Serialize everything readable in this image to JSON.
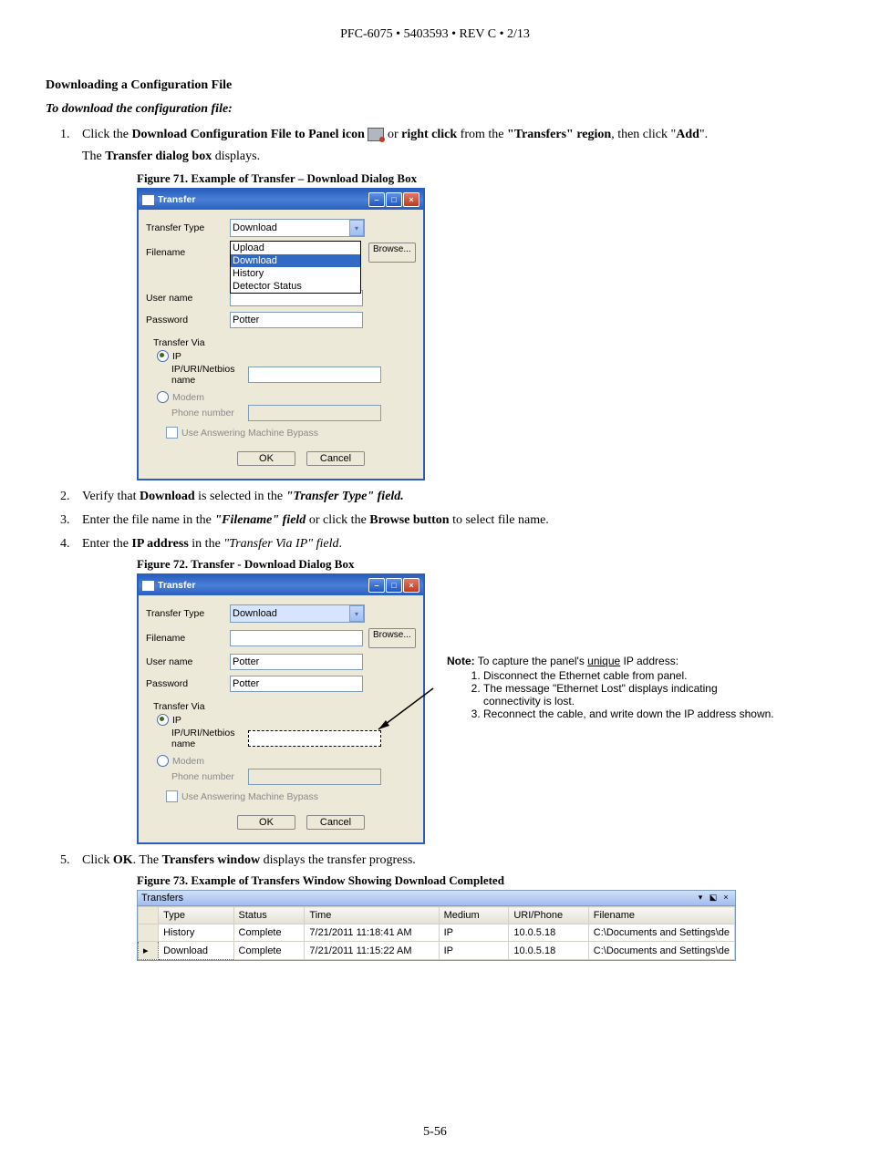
{
  "header": "PFC-6075 • 5403593 • REV C • 2/13",
  "section_title": "Downloading a Configuration File",
  "sub_instruction": "To download the configuration file:",
  "steps": {
    "s1_pre": "Click the ",
    "s1_b1": "Download Configuration File to Panel icon ",
    "s1_mid": " or ",
    "s1_b2": "right click",
    "s1_mid2": " from the ",
    "s1_b3": "\"Transfers\" region",
    "s1_mid3": ", then click \"",
    "s1_b4": "Add",
    "s1_end": "\".",
    "s1_sub_a": "The ",
    "s1_sub_b": "Transfer dialog box",
    "s1_sub_c": " displays.",
    "s2_a": "Verify that ",
    "s2_b": "Download",
    "s2_c": " is selected in the ",
    "s2_d": "\"Transfer Type\" field.",
    "s3_a": "Enter the file name in the ",
    "s3_b": "\"Filename\" field",
    "s3_c": " or click the ",
    "s3_d": "Browse button",
    "s3_e": " to select file name.",
    "s4_a": "Enter the ",
    "s4_b": "IP address",
    "s4_c": " in the ",
    "s4_d": "\"Transfer Via IP\" field",
    "s4_e": ".",
    "s5_a": "Click ",
    "s5_b": "OK",
    "s5_c": ". The ",
    "s5_d": "Transfers window",
    "s5_e": " displays the transfer progress."
  },
  "captions": {
    "fig71": "Figure 71.  Example of Transfer – Download Dialog Box",
    "fig72": "Figure 72.  Transfer - Download Dialog Box",
    "fig73": "Figure 73. Example of Transfers Window Showing Download Completed"
  },
  "dialog": {
    "title": "Transfer",
    "labels": {
      "transfer_type": "Transfer Type",
      "filename": "Filename",
      "user_name": "User name",
      "password": "Password",
      "transfer_via": "Transfer Via",
      "ip": "IP",
      "ip_field": "IP/URI/Netbios name",
      "modem": "Modem",
      "phone": "Phone number",
      "bypass": "Use Answering Machine Bypass"
    },
    "select_value": "Download",
    "dropdown": [
      "Upload",
      "Download",
      "History",
      "Detector Status"
    ],
    "values_fig72": {
      "user": "Potter",
      "password": "Potter"
    },
    "buttons": {
      "browse": "Browse...",
      "ok": "OK",
      "cancel": "Cancel"
    }
  },
  "note": {
    "prefix": "Note:",
    "text": " To capture the panel's ",
    "underline": "unique",
    "text2": " IP address:",
    "items": [
      "Disconnect the Ethernet cable from panel.",
      "The message \"Ethernet Lost\" displays indicating connectivity is lost.",
      "Reconnect the cable, and write down the IP address shown."
    ]
  },
  "transfers": {
    "title": "Transfers",
    "pin": "▾ ⬕",
    "columns": [
      "Type",
      "Status",
      "Time",
      "Medium",
      "URI/Phone",
      "Filename"
    ],
    "rows": [
      {
        "marker": "",
        "type": "History",
        "status": "Complete",
        "time": "7/21/2011 11:18:41 AM",
        "medium": "IP",
        "uri": "10.0.5.18",
        "filename": "C:\\Documents and Settings\\de"
      },
      {
        "marker": "▸",
        "type": "Download",
        "status": "Complete",
        "time": "7/21/2011 11:15:22 AM",
        "medium": "IP",
        "uri": "10.0.5.18",
        "filename": "C:\\Documents and Settings\\de"
      }
    ]
  },
  "page_num": "5-56"
}
